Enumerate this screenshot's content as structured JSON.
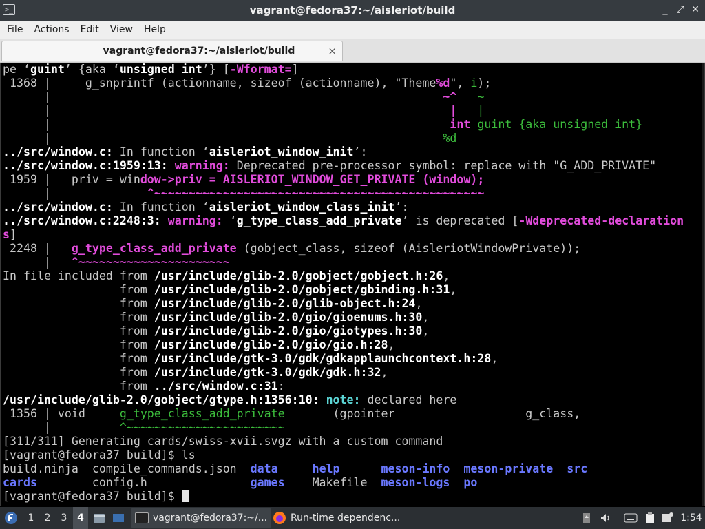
{
  "window": {
    "title": "vagrant@fedora37:~/aisleriot/build",
    "app_icon_glyph": ">_",
    "controls": {
      "minimize": "_",
      "maximize": "⤢",
      "close": "✕"
    }
  },
  "menubar": {
    "items": [
      "File",
      "Actions",
      "Edit",
      "View",
      "Help"
    ]
  },
  "tab": {
    "label": "vagrant@fedora37:~/aisleriot/build",
    "close": "×"
  },
  "terminal": {
    "lines": [
      [
        {
          "t": "pe ‘"
        },
        {
          "t": "guint",
          "s": "b"
        },
        {
          "t": "’ {aka ‘"
        },
        {
          "t": "unsigned int",
          "s": "b"
        },
        {
          "t": "’} ["
        },
        {
          "t": "-Wformat=",
          "s": "w"
        },
        {
          "t": "]"
        }
      ],
      [
        {
          "t": " 1368 |     g_snprintf (actionname, sizeof (actionname), \"Theme"
        },
        {
          "t": "%d",
          "s": "w"
        },
        {
          "t": "\", "
        },
        {
          "t": "i",
          "s": "g"
        },
        {
          "t": ");"
        }
      ],
      [
        {
          "t": "      |                                                         "
        },
        {
          "t": "~^",
          "s": "w"
        },
        {
          "t": "   "
        },
        {
          "t": "~",
          "s": "g"
        }
      ],
      [
        {
          "t": "      |                                                          "
        },
        {
          "t": "|",
          "s": "w"
        },
        {
          "t": "   "
        },
        {
          "t": "|",
          "s": "g"
        }
      ],
      [
        {
          "t": "      |                                                          "
        },
        {
          "t": "int",
          "s": "w"
        },
        {
          "t": " "
        },
        {
          "t": "guint {aka unsigned int}",
          "s": "g"
        }
      ],
      [
        {
          "t": "      |                                                         "
        },
        {
          "t": "%d",
          "s": "g"
        }
      ],
      [
        {
          "t": "../src/window.c:",
          "s": "b"
        },
        {
          "t": " In function ‘"
        },
        {
          "t": "aisleriot_window_init",
          "s": "b"
        },
        {
          "t": "’:"
        }
      ],
      [
        {
          "t": "../src/window.c:1959:13:",
          "s": "b"
        },
        {
          "t": " "
        },
        {
          "t": "warning:",
          "s": "w"
        },
        {
          "t": " Deprecated pre-processor symbol: replace with \"G_ADD_PRIVATE\""
        }
      ],
      [
        {
          "t": " 1959 |   priv = win"
        },
        {
          "t": "dow->priv = AISLERIOT_WINDOW_GET_PRIVATE (window);",
          "s": "w"
        }
      ],
      [
        {
          "t": "      |              "
        },
        {
          "t": "^~~~~~~~~~~~~~~~~~~~~~~~~~~~~~~~~~~~~~~~~~~~~~~~~",
          "s": "w"
        }
      ],
      [
        {
          "t": "../src/window.c:",
          "s": "b"
        },
        {
          "t": " In function ‘"
        },
        {
          "t": "aisleriot_window_class_init",
          "s": "b"
        },
        {
          "t": "’:"
        }
      ],
      [
        {
          "t": "../src/window.c:2248:3:",
          "s": "b"
        },
        {
          "t": " "
        },
        {
          "t": "warning:",
          "s": "w"
        },
        {
          "t": " ‘"
        },
        {
          "t": "g_type_class_add_private",
          "s": "b"
        },
        {
          "t": "’ is deprecated ["
        },
        {
          "t": "-Wdeprecated-declaration",
          "s": "w"
        }
      ],
      [
        {
          "t": "s",
          "s": "w"
        },
        {
          "t": "]"
        }
      ],
      [
        {
          "t": " 2248 |   "
        },
        {
          "t": "g_type_class_add_private",
          "s": "w"
        },
        {
          "t": " (gobject_class, sizeof (AisleriotWindowPrivate));"
        }
      ],
      [
        {
          "t": "      |   "
        },
        {
          "t": "^~~~~~~~~~~~~~~~~~~~~~~",
          "s": "w"
        }
      ],
      [
        {
          "t": "In file included from "
        },
        {
          "t": "/usr/include/glib-2.0/gobject/gobject.h:26",
          "s": "b"
        },
        {
          "t": ","
        }
      ],
      [
        {
          "t": "                 from "
        },
        {
          "t": "/usr/include/glib-2.0/gobject/gbinding.h:31",
          "s": "b"
        },
        {
          "t": ","
        }
      ],
      [
        {
          "t": "                 from "
        },
        {
          "t": "/usr/include/glib-2.0/glib-object.h:24",
          "s": "b"
        },
        {
          "t": ","
        }
      ],
      [
        {
          "t": "                 from "
        },
        {
          "t": "/usr/include/glib-2.0/gio/gioenums.h:30",
          "s": "b"
        },
        {
          "t": ","
        }
      ],
      [
        {
          "t": "                 from "
        },
        {
          "t": "/usr/include/glib-2.0/gio/giotypes.h:30",
          "s": "b"
        },
        {
          "t": ","
        }
      ],
      [
        {
          "t": "                 from "
        },
        {
          "t": "/usr/include/glib-2.0/gio/gio.h:28",
          "s": "b"
        },
        {
          "t": ","
        }
      ],
      [
        {
          "t": "                 from "
        },
        {
          "t": "/usr/include/gtk-3.0/gdk/gdkapplaunchcontext.h:28",
          "s": "b"
        },
        {
          "t": ","
        }
      ],
      [
        {
          "t": "                 from "
        },
        {
          "t": "/usr/include/gtk-3.0/gdk/gdk.h:32",
          "s": "b"
        },
        {
          "t": ","
        }
      ],
      [
        {
          "t": "                 from "
        },
        {
          "t": "../src/window.c:31",
          "s": "b"
        },
        {
          "t": ":"
        }
      ],
      [
        {
          "t": "/usr/include/glib-2.0/gobject/gtype.h:1356:10:",
          "s": "b"
        },
        {
          "t": " "
        },
        {
          "t": "note:",
          "s": "c"
        },
        {
          "t": " declared here"
        }
      ],
      [
        {
          "t": " 1356 | void     "
        },
        {
          "t": "g_type_class_add_private",
          "s": "g"
        },
        {
          "t": "       (gpointer                   g_class,"
        }
      ],
      [
        {
          "t": "      |          "
        },
        {
          "t": "^~~~~~~~~~~~~~~~~~~~~~~~",
          "s": "g"
        }
      ],
      [
        {
          "t": "[311/311] Generating cards/swiss-xvii.svgz with a custom command"
        }
      ],
      [
        {
          "t": "[vagrant@fedora37 build]$ ls"
        }
      ],
      [
        {
          "t": "build.ninja  compile_commands.json  "
        },
        {
          "t": "data",
          "s": "bl"
        },
        {
          "t": "     "
        },
        {
          "t": "help",
          "s": "bl"
        },
        {
          "t": "      "
        },
        {
          "t": "meson-info",
          "s": "bl"
        },
        {
          "t": "  "
        },
        {
          "t": "meson-private",
          "s": "bl"
        },
        {
          "t": "  "
        },
        {
          "t": "src",
          "s": "bl"
        }
      ],
      [
        {
          "t": "cards",
          "s": "bl"
        },
        {
          "t": "        config.h               "
        },
        {
          "t": "games",
          "s": "bl"
        },
        {
          "t": "    Makefile  "
        },
        {
          "t": "meson-logs",
          "s": "bl"
        },
        {
          "t": "  "
        },
        {
          "t": "po",
          "s": "bl"
        }
      ],
      [
        {
          "t": "[vagrant@fedora37 build]$ "
        },
        {
          "t": "",
          "s": "cursor"
        }
      ]
    ]
  },
  "taskbar": {
    "start_icon": "fedora-logo-icon",
    "workspaces": [
      "1",
      "2",
      "3",
      "4"
    ],
    "active_workspace": "4",
    "tasks": [
      {
        "label": "vagrant@fedora37:~/...",
        "icon": "terminal-icon"
      },
      {
        "label": "Run-time dependenc...",
        "icon": "firefox-icon"
      }
    ],
    "clock": "1:54"
  }
}
